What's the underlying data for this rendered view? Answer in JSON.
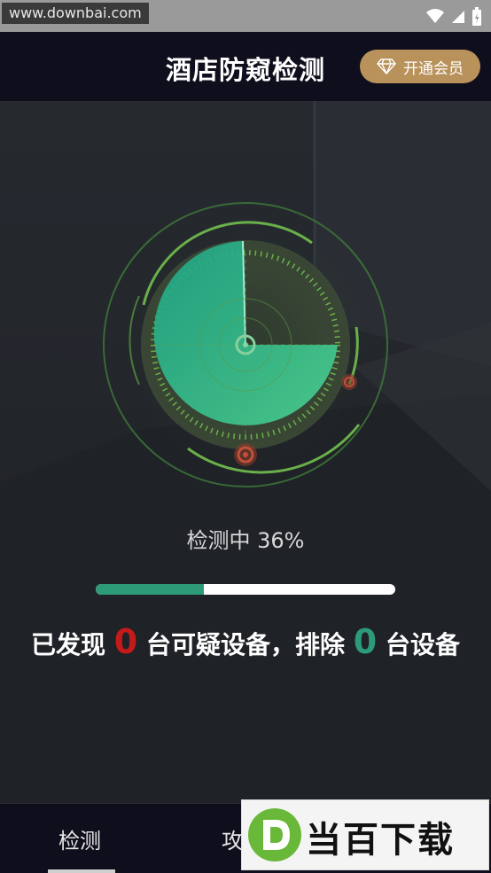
{
  "status_bar": {
    "watermark_url": "www.downbai.com",
    "icons": [
      "wifi-icon",
      "signal-icon",
      "battery-icon"
    ]
  },
  "header": {
    "title": "酒店防窥检测",
    "vip_button": "开通会员",
    "vip_icon": "diamond-icon"
  },
  "scan": {
    "status_text": "检测中 36%",
    "progress": 0.36,
    "result": {
      "prefix": "已发现",
      "suspicious_count": "0",
      "middle": "台可疑设备，排除",
      "excluded_count": "0",
      "suffix": "台设备"
    }
  },
  "bottom_nav": {
    "items": [
      {
        "label": "检测",
        "active": true
      },
      {
        "label": "攻略",
        "active": false
      }
    ]
  },
  "watermark_logo": {
    "text": "当百下载"
  },
  "colors": {
    "accent": "#2d9a78",
    "alert": "#c41a1a",
    "vip": "#b8925a",
    "header_bg": "#0f0e1c"
  }
}
